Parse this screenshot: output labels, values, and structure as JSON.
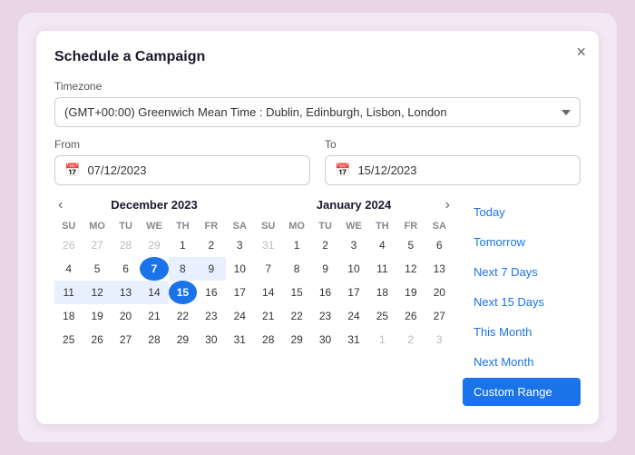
{
  "modal": {
    "title": "Schedule a Campaign",
    "close_label": "×"
  },
  "timezone": {
    "label": "Timezone",
    "value": "(GMT+00:00) Greenwich Mean Time : Dublin, Edinburgh, Lisbon, London"
  },
  "from": {
    "label": "From",
    "value": "07/12/2023"
  },
  "to": {
    "label": "To",
    "value": "15/12/2023"
  },
  "calendars": [
    {
      "title": "December 2023",
      "days_header": [
        "SU",
        "MO",
        "TU",
        "WE",
        "TH",
        "FR",
        "SA"
      ],
      "weeks": [
        [
          "26",
          "27",
          "28",
          "29",
          "1",
          "2",
          "3"
        ],
        [
          "4",
          "5",
          "6",
          "7",
          "8",
          "9",
          "10"
        ],
        [
          "11",
          "12",
          "13",
          "14",
          "15",
          "16",
          "17"
        ],
        [
          "18",
          "19",
          "20",
          "21",
          "22",
          "23",
          "24"
        ],
        [
          "25",
          "26",
          "27",
          "28",
          "29",
          "30",
          "31"
        ]
      ],
      "other_month_days": [
        "26",
        "27",
        "28",
        "29",
        "26",
        "27",
        "28",
        "29",
        "30",
        "31"
      ],
      "selected_start": "7",
      "selected_end": "15",
      "range": [
        "8",
        "9",
        "10",
        "11",
        "12",
        "13",
        "14"
      ]
    },
    {
      "title": "January 2024",
      "days_header": [
        "SU",
        "MO",
        "TU",
        "WE",
        "TH",
        "FR",
        "SA"
      ],
      "weeks": [
        [
          "31",
          "1",
          "2",
          "3",
          "4",
          "5",
          "6"
        ],
        [
          "7",
          "8",
          "9",
          "10",
          "11",
          "12",
          "13"
        ],
        [
          "14",
          "15",
          "16",
          "17",
          "18",
          "19",
          "20"
        ],
        [
          "21",
          "22",
          "23",
          "24",
          "25",
          "26",
          "27"
        ],
        [
          "28",
          "29",
          "30",
          "31",
          "1",
          "2",
          "3"
        ]
      ],
      "other_month_start": [
        "31"
      ],
      "other_month_end": [
        "1",
        "2",
        "3"
      ]
    }
  ],
  "quick_select": {
    "buttons": [
      {
        "label": "Today",
        "active": false
      },
      {
        "label": "Tomorrow",
        "active": false
      },
      {
        "label": "Next 7 Days",
        "active": false
      },
      {
        "label": "Next 15 Days",
        "active": false
      },
      {
        "label": "This Month",
        "active": false
      },
      {
        "label": "Next Month",
        "active": false
      },
      {
        "label": "Custom Range",
        "active": true
      }
    ]
  }
}
